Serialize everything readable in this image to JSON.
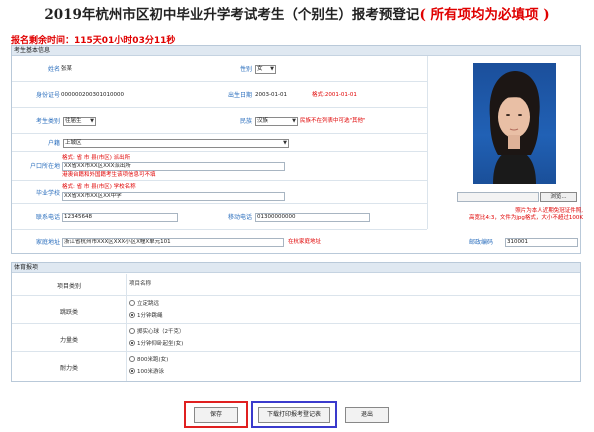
{
  "title": {
    "main": "2019年杭州市区初中毕业升学考试考生（个别生）报考预登记",
    "required": "( 所有项均为必填项 )"
  },
  "countdown": "报名剩余时间：115天01小时03分11秒",
  "basic": {
    "header": "考生基本信息",
    "name": {
      "label": "姓名",
      "value": "张某"
    },
    "gender": {
      "label": "性别",
      "value": "女"
    },
    "id_no": {
      "label": "身份证号",
      "value": "000000200301010000"
    },
    "birth": {
      "label": "出生日期",
      "value": "2003-01-01",
      "hint": "格式:2001-01-01"
    },
    "category": {
      "label": "考生类别",
      "value": "往届生"
    },
    "ethnic": {
      "label": "民族",
      "value": "汉族",
      "hint": "民族不在列表中可选\"其他\""
    },
    "hukou": {
      "label": "户籍",
      "value": "上城区"
    },
    "hukou_addr": {
      "label": "户口所在地",
      "hint": "格式:      省      市      县(市区)      派出所",
      "value": "XX省XX市XX区XXX派出所",
      "note": "港澳台籍和外国籍考生该项信息可不填"
    },
    "school": {
      "label": "毕业学校",
      "hint": "格式:      省      市      县(市区)      学校名称",
      "value": "XX省XX市XX区XX中学"
    },
    "phone": {
      "label": "联系电话",
      "value": "12345648"
    },
    "mobile": {
      "label": "移动电话",
      "value": "01300000000"
    },
    "address": {
      "label": "家庭地址",
      "value": "浙江省杭州市XXX区XXX小区X幢X单元101",
      "hint": "在杭家庭地址"
    },
    "postcode": {
      "label": "邮政编码",
      "value": "310001"
    },
    "photo": {
      "browse": "浏览...",
      "note1": "照片为本人近期免冠证件照,",
      "note2": "高宽比4:3，文件为jpg格式，大小不超过100K"
    }
  },
  "sports": {
    "header": "体育报项",
    "col_category": "项目类别",
    "col_name": "项目名称",
    "groups": [
      {
        "category": "跳跃类",
        "options": [
          {
            "label": "立定跳远",
            "selected": false
          },
          {
            "label": "1分钟跳绳",
            "selected": true
          }
        ]
      },
      {
        "category": "力量类",
        "options": [
          {
            "label": "掷实心球（2千克）",
            "selected": false
          },
          {
            "label": "1分钟仰卧起坐(女)",
            "selected": true
          }
        ]
      },
      {
        "category": "耐力类",
        "options": [
          {
            "label": "800米跑(女)",
            "selected": false
          },
          {
            "label": "100米游泳",
            "selected": true
          }
        ]
      }
    ]
  },
  "buttons": {
    "save": "保存",
    "download": "下载打印报考登记表",
    "exit": "退出"
  }
}
